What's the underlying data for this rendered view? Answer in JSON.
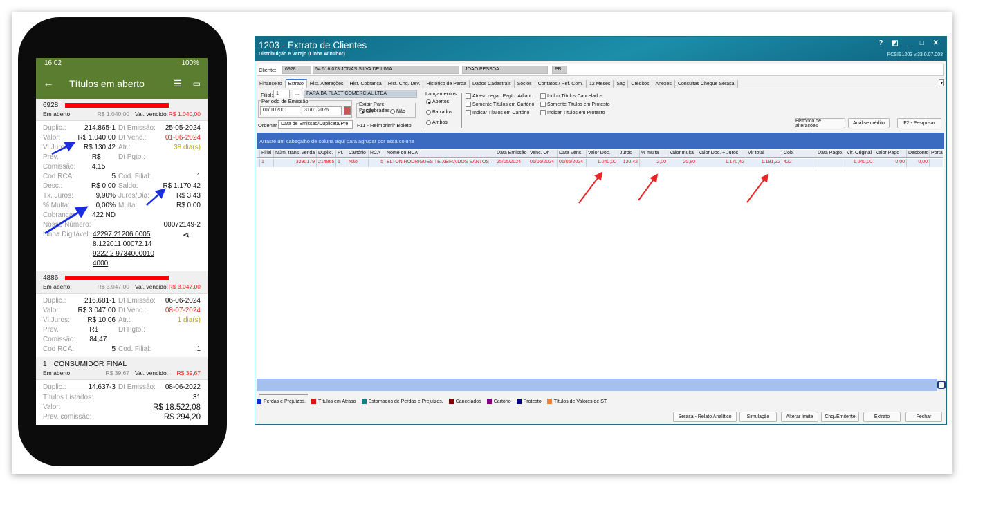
{
  "phone": {
    "status": {
      "time": "16:02",
      "icons": "mail-icon battery-icon",
      "battery": "100%"
    },
    "title": "Títulos em aberto",
    "groups": [
      {
        "code": "6928",
        "name": "",
        "open_label": "Em aberto:",
        "open_value": "R$ 1.040,00",
        "due_label": "Val. vencido:",
        "due_value": "R$ 1.040,00",
        "rows": [
          [
            "Duplic.:",
            "214.865-1",
            "Dt Emissão:",
            "25-05-2024"
          ],
          [
            "Valor:",
            "R$ 1.040,00",
            "Dt Venc.:",
            "01-06-2024"
          ],
          [
            "Vl.Juros:",
            "R$ 130,42",
            "Atr.:",
            "38 dia(s)"
          ],
          [
            "Prev. Comissão:",
            "R$ 4,15",
            "Dt Pgto.:",
            ""
          ],
          [
            "Cod RCA:",
            "5",
            "Cod. Filial:",
            "1"
          ],
          [
            "Desc.:",
            "R$ 0,00",
            "Saldo:",
            "R$ 1.170,42"
          ],
          [
            "Tx. Juros:",
            "9,90%",
            "Juros/Dia:",
            "R$ 3,43"
          ],
          [
            "% Multa:",
            "0,00%",
            "Multa:",
            "R$ 0,00"
          ],
          [
            "Cobrança:",
            "422 ND",
            "",
            ""
          ]
        ],
        "nosso_label": "Nosso Número:",
        "nosso_value": "00072149-2",
        "linha_label": "Linha Digitável:",
        "linha_value": "42297.21206 00058.122011 00072.149222 2 97340000104000"
      },
      {
        "code": "4886",
        "name": "",
        "open_label": "Em aberto:",
        "open_value": "R$ 3.047,00",
        "due_label": "Val. vencido:",
        "due_value": "R$ 3.047,00",
        "rows": [
          [
            "Duplic.:",
            "216.681-1",
            "Dt Emissão:",
            "06-06-2024"
          ],
          [
            "Valor:",
            "R$ 3.047,00",
            "Dt Venc.:",
            "08-07-2024"
          ],
          [
            "Vl.Juros:",
            "R$ 10,06",
            "Atr.:",
            "1 dia(s)"
          ],
          [
            "Prev. Comissão:",
            "R$ 84,47",
            "Dt Pgto.:",
            ""
          ],
          [
            "Cod RCA:",
            "5",
            "Cod. Filial:",
            "1"
          ]
        ]
      },
      {
        "code": "1",
        "name": "CONSUMIDOR FINAL",
        "open_label": "Em aberto:",
        "open_value": "R$ 39,67",
        "due_label": "Val. vencido:",
        "due_value": "R$ 39,67",
        "rows": [
          [
            "Duplic.:",
            "14.637-3",
            "Dt Emissão:",
            "08-06-2022"
          ]
        ]
      }
    ],
    "summary": [
      [
        "Títulos Listados:",
        "31"
      ],
      [
        "Valor:",
        "R$ 18.522,08"
      ],
      [
        "Prev. comissão:",
        "R$ 294,20"
      ]
    ]
  },
  "app": {
    "title": "1203 - Extrato de Clientes",
    "subtitle": "Distribuição e Varejo (Linha WinThor)",
    "window_controls": "? ◩ _ □ ✕",
    "version": "PCSIS1203  v.33.0.07.003",
    "client": {
      "label": "Cliente:",
      "code": "6928",
      "name": "54.516.073 JONAS SILVA DE LIMA",
      "city": "JOAO PESSOA",
      "uf": "PB"
    },
    "tabs": [
      "Financeiro",
      "Extrato",
      "Hist. Alterações",
      "Hist. Cobrança",
      "Hist. Chq. Dev.",
      "Histórico de Perda",
      "Dados Cadastrais",
      "Sócios",
      "Contatos / Ref. Com.",
      "12 Meses",
      "Saç",
      "Créditos",
      "Anexos",
      "Consultas Cheque Serasa"
    ],
    "active_tab": 1,
    "filial": {
      "label": "Filial:",
      "value": "1",
      "btn": "...",
      "name": "PARAIBA PLAST COMERCIAL LTDA"
    },
    "periodo": {
      "label": "Período de Emissão",
      "from": "01/01/2001",
      "to": "31/01/2026"
    },
    "exibir": {
      "label": "Exibir Parc. Desdobradas",
      "opt1": "Sim",
      "opt2": "Não"
    },
    "ordenar": {
      "label": "Ordenar",
      "value": "Data de Emissao/Duplicata/Pre",
      "f11": "F11 - Reimprimir Boleto"
    },
    "lancamentos": {
      "label": "Lançamentos",
      "options": [
        "Abertos",
        "Baixados",
        "Ambos"
      ]
    },
    "checks": [
      "Atraso negat. Pagto. Adiant.",
      "Somente Títulos em Cartório",
      "Indicar Títulos em Cartório",
      "Incluir Títulos Cancelados",
      "Somente Títulos em Protesto",
      "Indicar Títulos em Protesto"
    ],
    "top_buttons": [
      "Histórico de alterações",
      "Análise crédito",
      "F2 - Pesquisar"
    ],
    "group_hint": "Arraste um cabeçalho de coluna aqui para agrupar por essa coluna",
    "columns": [
      "Filial",
      "Núm. trans. venda",
      "Duplic.",
      "Pr.",
      "Cartório",
      "RCA",
      "Nome do RCA",
      "Data Emissão",
      "Venc. Or",
      "Data Venc.",
      "Valor Doc.",
      "Juros",
      "% multa",
      "Valor multa",
      "Valor Doc. + Juros",
      "Vlr total",
      "Cob.",
      "Data Pagto.",
      "Vlr. Original",
      "Valor Pago",
      "Desconto",
      "Porta"
    ],
    "rows": [
      [
        "1",
        "3290179",
        "214865",
        "1",
        "Não",
        "5",
        "ELTON RODRIGUES TEIXEIRA DOS SANTOS",
        "25/05/2024",
        "01/06/2024",
        "01/06/2024",
        "1.040,00",
        "130,42",
        "2,00",
        "20,80",
        "1.170,42",
        "1.191,22",
        "422",
        "",
        "1.040,00",
        "0,00",
        "0,00",
        ""
      ]
    ],
    "legend": [
      {
        "label": "Perdas e Prejuízos.",
        "color": "#1030d0"
      },
      {
        "label": "Títulos em Atraso",
        "color": "#e01010"
      },
      {
        "label": "Estornados de Perdas e Prejuízos.",
        "color": "#108080"
      },
      {
        "label": "Cancelados",
        "color": "#800000"
      },
      {
        "label": "Cartório",
        "color": "#800080"
      },
      {
        "label": "Protesto",
        "color": "#000080"
      },
      {
        "label": "Títulos de Valores de ST",
        "color": "#f08030"
      }
    ],
    "bottom_buttons": [
      "Serasa - Relato Analítico",
      "Simulação",
      "Alterar limite",
      "Chq./Emitente",
      "Extrato",
      "Fechar"
    ]
  }
}
